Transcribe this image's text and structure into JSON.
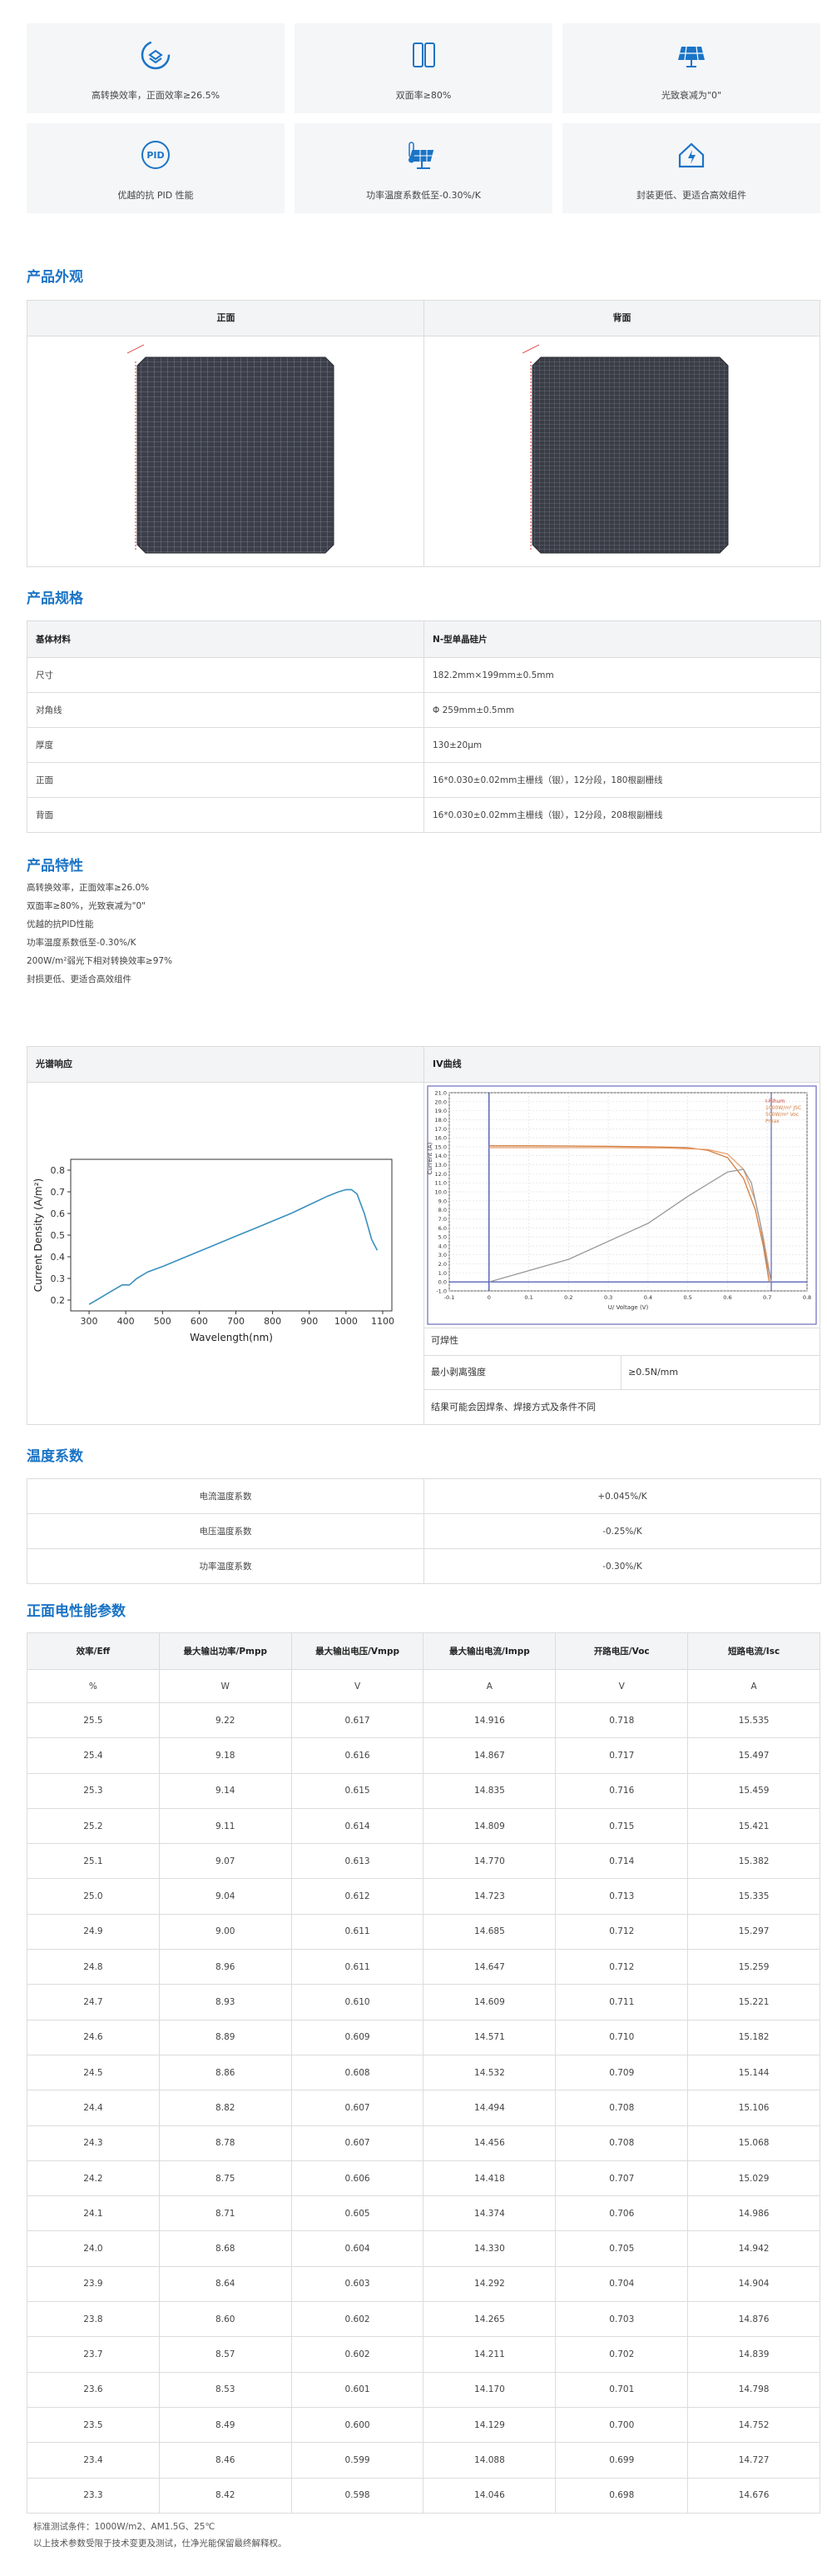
{
  "features": [
    {
      "icon": "high-efficiency-icon",
      "text": "高转换效率，正面效率≥26.5%"
    },
    {
      "icon": "bifacial-icon",
      "text": "双面率≥80%"
    },
    {
      "icon": "solar-panel-icon",
      "text": "光致衰减为\"0\""
    },
    {
      "icon": "pid-icon",
      "text": "优越的抗 PID 性能"
    },
    {
      "icon": "temperature-icon",
      "text": "功率温度系数低至-0.30%/K"
    },
    {
      "icon": "home-cost-icon",
      "text": "封装更低、更适合高效组件"
    }
  ],
  "appearance": {
    "title": "产品外观",
    "front": "正面",
    "back": "背面"
  },
  "specs": {
    "title": "产品规格",
    "header": [
      "基体材料",
      "N-型单晶硅片"
    ],
    "rows": [
      [
        "尺寸",
        "182.2mm×199mm±0.5mm"
      ],
      [
        "对角线",
        "Φ 259mm±0.5mm"
      ],
      [
        "厚度",
        "130±20μm"
      ],
      [
        "正面",
        "16*0.030±0.02mm主栅线（银），12分段，180根副栅线"
      ],
      [
        "背面",
        "16*0.030±0.02mm主栅线（银），12分段，208根副栅线"
      ]
    ]
  },
  "characteristics": {
    "title": "产品特性",
    "items": [
      "高转换效率，正面效率≥26.0%",
      "双面率≥80%，光致衰减为\"0\"",
      "优越的抗PID性能",
      "功率温度系数低至-0.30%/K",
      "200W/m²弱光下相对转换效率≥97%",
      "封损更低、更适合高效组件"
    ]
  },
  "spectral": {
    "header": "光谱响应",
    "chart_data": {
      "type": "line",
      "xlabel": "Wavelength(nm)",
      "ylabel": "Current Density (A/m²)",
      "xlim": [
        250,
        1125
      ],
      "ylim": [
        0.15,
        0.85
      ],
      "xticks": [
        300,
        400,
        500,
        600,
        700,
        800,
        900,
        1000,
        1100
      ],
      "yticks": [
        0.2,
        0.3,
        0.4,
        0.5,
        0.6,
        0.7,
        0.8
      ],
      "series": [
        {
          "color": "#3a8fbf",
          "points": [
            [
              300,
              0.18
            ],
            [
              330,
              0.21
            ],
            [
              360,
              0.24
            ],
            [
              390,
              0.27
            ],
            [
              410,
              0.27
            ],
            [
              430,
              0.3
            ],
            [
              460,
              0.33
            ],
            [
              500,
              0.355
            ],
            [
              550,
              0.39
            ],
            [
              600,
              0.425
            ],
            [
              650,
              0.46
            ],
            [
              700,
              0.495
            ],
            [
              750,
              0.53
            ],
            [
              800,
              0.565
            ],
            [
              850,
              0.6
            ],
            [
              900,
              0.64
            ],
            [
              950,
              0.68
            ],
            [
              980,
              0.7
            ],
            [
              1000,
              0.71
            ],
            [
              1015,
              0.71
            ],
            [
              1030,
              0.69
            ],
            [
              1050,
              0.6
            ],
            [
              1070,
              0.48
            ],
            [
              1085,
              0.43
            ]
          ]
        }
      ]
    }
  },
  "iv": {
    "header": "IV曲线",
    "chart_data": {
      "type": "line",
      "xlabel": "U/ Voltage (V)",
      "ylabel": "Current (A)",
      "xlim": [
        -0.1,
        0.8
      ],
      "ylim": [
        -1,
        21
      ],
      "xticks": [
        -0.1,
        0,
        0.1,
        0.2,
        0.3,
        0.4,
        0.5,
        0.6,
        0.7,
        0.8
      ],
      "yticks": [
        -1,
        0,
        1,
        2,
        3,
        4,
        5,
        6,
        7,
        8,
        9,
        10,
        11,
        12,
        13,
        14,
        15,
        16,
        17,
        18,
        19,
        20,
        21
      ],
      "legend": [
        "I-Rihum",
        "1000W/m² JSC",
        "500W/m² Voc",
        "Pmax"
      ],
      "series": [
        {
          "color": "#d27a3a",
          "points": [
            [
              0,
              15.1
            ],
            [
              0.1,
              15.1
            ],
            [
              0.2,
              15.08
            ],
            [
              0.3,
              15.05
            ],
            [
              0.4,
              15.0
            ],
            [
              0.5,
              14.9
            ],
            [
              0.55,
              14.6
            ],
            [
              0.6,
              13.8
            ],
            [
              0.64,
              11.5
            ],
            [
              0.67,
              8
            ],
            [
              0.69,
              4
            ],
            [
              0.705,
              0
            ]
          ]
        },
        {
          "color": "#e8a070",
          "points": [
            [
              0,
              14.9
            ],
            [
              0.3,
              14.9
            ],
            [
              0.45,
              14.85
            ],
            [
              0.55,
              14.7
            ],
            [
              0.6,
              14.2
            ],
            [
              0.64,
              12.5
            ],
            [
              0.67,
              9
            ],
            [
              0.69,
              5
            ],
            [
              0.71,
              0
            ]
          ]
        },
        {
          "color": "#999999",
          "points": [
            [
              0,
              0
            ],
            [
              0.2,
              2.5
            ],
            [
              0.4,
              6.5
            ],
            [
              0.5,
              9.5
            ],
            [
              0.6,
              12.2
            ],
            [
              0.64,
              12.5
            ],
            [
              0.66,
              11
            ],
            [
              0.68,
              7
            ],
            [
              0.7,
              2
            ],
            [
              0.71,
              0
            ]
          ]
        }
      ]
    }
  },
  "solderability": {
    "title": "可焊性",
    "label": "最小剥离强度",
    "value": "≥0.5N/mm",
    "note": "结果可能会因焊条、焊接方式及条件不同"
  },
  "temperature": {
    "title": "温度系数",
    "rows": [
      [
        "电流温度系数",
        "+0.045%/K"
      ],
      [
        "电压温度系数",
        "-0.25%/K"
      ],
      [
        "功率温度系数",
        "-0.30%/K"
      ]
    ]
  },
  "electrical": {
    "title": "正面电性能参数",
    "headers": [
      "效率/Eff",
      "最大输出功率/Pmpp",
      "最大输出电压/Vmpp",
      "最大输出电流/Impp",
      "开路电压/Voc",
      "短路电流/Isc"
    ],
    "units": [
      "%",
      "W",
      "V",
      "A",
      "V",
      "A"
    ],
    "rows": [
      [
        "25.5",
        "9.22",
        "0.617",
        "14.916",
        "0.718",
        "15.535"
      ],
      [
        "25.4",
        "9.18",
        "0.616",
        "14.867",
        "0.717",
        "15.497"
      ],
      [
        "25.3",
        "9.14",
        "0.615",
        "14.835",
        "0.716",
        "15.459"
      ],
      [
        "25.2",
        "9.11",
        "0.614",
        "14.809",
        "0.715",
        "15.421"
      ],
      [
        "25.1",
        "9.07",
        "0.613",
        "14.770",
        "0.714",
        "15.382"
      ],
      [
        "25.0",
        "9.04",
        "0.612",
        "14.723",
        "0.713",
        "15.335"
      ],
      [
        "24.9",
        "9.00",
        "0.611",
        "14.685",
        "0.712",
        "15.297"
      ],
      [
        "24.8",
        "8.96",
        "0.611",
        "14.647",
        "0.712",
        "15.259"
      ],
      [
        "24.7",
        "8.93",
        "0.610",
        "14.609",
        "0.711",
        "15.221"
      ],
      [
        "24.6",
        "8.89",
        "0.609",
        "14.571",
        "0.710",
        "15.182"
      ],
      [
        "24.5",
        "8.86",
        "0.608",
        "14.532",
        "0.709",
        "15.144"
      ],
      [
        "24.4",
        "8.82",
        "0.607",
        "14.494",
        "0.708",
        "15.106"
      ],
      [
        "24.3",
        "8.78",
        "0.607",
        "14.456",
        "0.708",
        "15.068"
      ],
      [
        "24.2",
        "8.75",
        "0.606",
        "14.418",
        "0.707",
        "15.029"
      ],
      [
        "24.1",
        "8.71",
        "0.605",
        "14.374",
        "0.706",
        "14.986"
      ],
      [
        "24.0",
        "8.68",
        "0.604",
        "14.330",
        "0.705",
        "14.942"
      ],
      [
        "23.9",
        "8.64",
        "0.603",
        "14.292",
        "0.704",
        "14.904"
      ],
      [
        "23.8",
        "8.60",
        "0.602",
        "14.265",
        "0.703",
        "14.876"
      ],
      [
        "23.7",
        "8.57",
        "0.602",
        "14.211",
        "0.702",
        "14.839"
      ],
      [
        "23.6",
        "8.53",
        "0.601",
        "14.170",
        "0.701",
        "14.798"
      ],
      [
        "23.5",
        "8.49",
        "0.600",
        "14.129",
        "0.700",
        "14.752"
      ],
      [
        "23.4",
        "8.46",
        "0.599",
        "14.088",
        "0.699",
        "14.727"
      ],
      [
        "23.3",
        "8.42",
        "0.598",
        "14.046",
        "0.698",
        "14.676"
      ]
    ],
    "footnotes": [
      "标准测试条件：1000W/m2、AM1.5G、25℃",
      "以上技术参数受限于技术变更及测试，仕净光能保留最终解释权。"
    ]
  },
  "colors": {
    "accent": "#1b74c6",
    "panel_bg": "#f5f6f8",
    "border": "#dcdcdc"
  }
}
